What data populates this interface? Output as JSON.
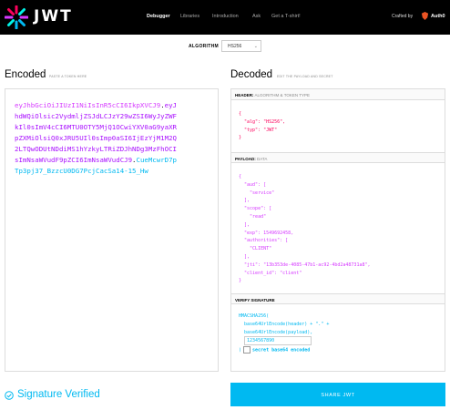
{
  "brand": {
    "logo_word": "JWT"
  },
  "nav": {
    "items": [
      "Debugger",
      "Libraries",
      "Introduction",
      "Ask",
      "Get a T-shirt!"
    ]
  },
  "crafted": {
    "label": "Crafted by",
    "brand": "Auth0"
  },
  "algorithm": {
    "label": "ALGORITHM",
    "value": "HS256"
  },
  "encoded": {
    "title": "Encoded",
    "subtitle": "PASTE A TOKEN HERE",
    "header_part": "eyJhbGciOiJIUzI1NiIsInR5cCI6IkpXVCJ9",
    "payload_part": "eyJhdWQiOlsic2VydmljZSJdLCJzY29wZSI6WyJyZWFkIl0sImV4cCI6MTU0OTY5MjQ1OCwiYXV0aG9yaXRpZXMiOlsiQ0xJRU5UIl0sImp0aSI6IjEzYjM1M2RlLTQwODUtNDdiMS1hYzkyLTRiZDJhNDg3MzFhOCIsImNsaWVudF9pZCI6ImNsaWVudCJ9",
    "signature_part": "CueMcwrD7pTp3pj37_BzzcU0DG7PcjCacSa14-15_Hw",
    "lines": [
      [
        [
          "h",
          "eyJhbGciOiJIUzI1NiIsInR5cCI6IkpXVCJ9"
        ],
        [
          "d",
          "."
        ],
        [
          "p",
          "eyJ"
        ]
      ],
      [
        [
          "p",
          "hdWQiOlsic2VydmljZSJdLCJzY29wZSI6WyJyZWF"
        ]
      ],
      [
        [
          "p",
          "kIl0sImV4cCI6MTU0OTY5MjQ1OCwiYXV0aG9yaXR"
        ]
      ],
      [
        [
          "p",
          "pZXMiOlsiQ0xJRU5UIl0sImp0aSI6IjEzYjM1M2Q"
        ]
      ],
      [
        [
          "p",
          "2LTQwODUtNDdiMS1hYzkyLTRiZDJhNDg3MzFhOCI"
        ]
      ],
      [
        [
          "p",
          "sImNsaWVudF9pZCI6ImNsaWVudCJ9"
        ],
        [
          "d",
          "."
        ],
        [
          "s",
          "CueMcwrD7p"
        ]
      ],
      [
        [
          "s",
          "Tp3pj37_BzzcU0DG7PcjCacSa14-15_Hw"
        ]
      ]
    ]
  },
  "decoded": {
    "title": "Decoded",
    "subtitle": "EDIT THE PAYLOAD AND SECRET",
    "header_section": {
      "label": "HEADER:",
      "sub": "ALGORITHM & TOKEN TYPE"
    },
    "header_json": "{\n  \"alg\": \"HS256\",\n  \"typ\": \"JWT\"\n}",
    "payload_section": {
      "label": "PAYLOAD:",
      "sub": "DATA"
    },
    "payload_json": "{\n  \"aud\": [\n    \"service\"\n  ],\n  \"scope\": [\n    \"read\"\n  ],\n  \"exp\": 1549692458,\n  \"authorities\": [\n    \"CLIENT\"\n  ],\n  \"jti\": \"13b353de-4085-47b1-ac92-4bd2a48731a8\",\n  \"client_id\": \"client\"\n}",
    "verify_section": {
      "label": "VERIFY SIGNATURE"
    },
    "verify_line1": "HMACSHA256(",
    "verify_line2": "  base64UrlEncode(header) + \".\" +",
    "verify_line3": "  base64UrlEncode(payload),",
    "secret_value": "1234567890",
    "verify_close": ")",
    "secret_encoded_label": "secret base64 encoded"
  },
  "status": {
    "text": "Signature Verified"
  },
  "share_button": "SHARE JWT",
  "colors": {
    "header_color": "#fb015b",
    "payload_color": "#d63aff",
    "signature_color": "#00b9f1"
  }
}
